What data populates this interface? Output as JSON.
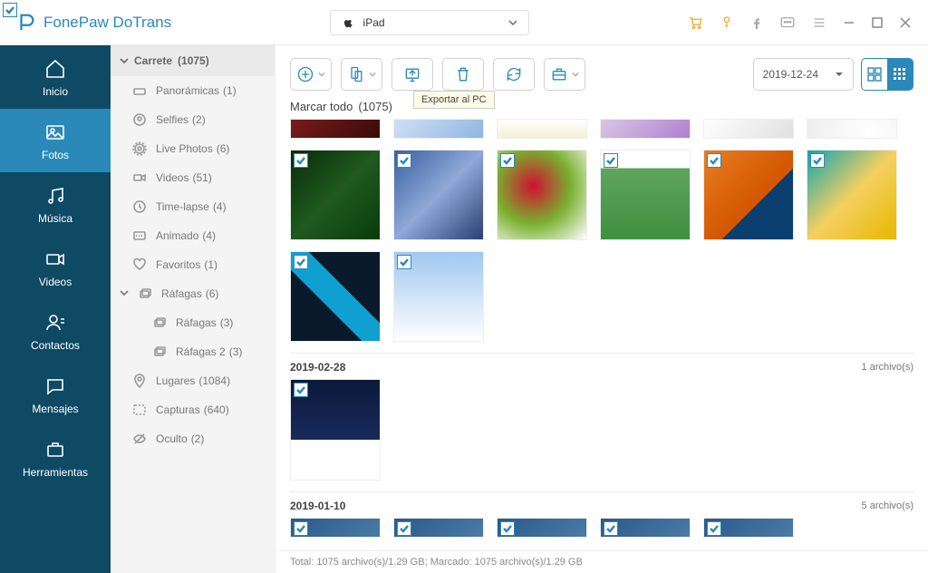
{
  "app": {
    "name": "FonePaw DoTrans"
  },
  "device": {
    "name": "iPad"
  },
  "sidebar": [
    {
      "key": "inicio",
      "label": "Inicio"
    },
    {
      "key": "fotos",
      "label": "Fotos"
    },
    {
      "key": "musica",
      "label": "Música"
    },
    {
      "key": "videos",
      "label": "Videos"
    },
    {
      "key": "contactos",
      "label": "Contactos"
    },
    {
      "key": "mensajes",
      "label": "Mensajes"
    },
    {
      "key": "herramientas",
      "label": "Herramientas"
    }
  ],
  "subsidebar": {
    "header": {
      "label": "Carrete",
      "count": "(1075)"
    },
    "items": [
      {
        "label": "Panorámicas",
        "count": "(1)"
      },
      {
        "label": "Selfies",
        "count": "(2)"
      },
      {
        "label": "Live Photos",
        "count": "(6)"
      },
      {
        "label": "Videos",
        "count": "(51)"
      },
      {
        "label": "Time-lapse",
        "count": "(4)"
      },
      {
        "label": "Animado",
        "count": "(4)"
      },
      {
        "label": "Favoritos",
        "count": "(1)"
      },
      {
        "expand": true,
        "label": "Ráfagas",
        "count": "(6)"
      },
      {
        "indent": true,
        "label": "Ráfagas",
        "count": "(3)"
      },
      {
        "indent": true,
        "label": "Ráfagas 2",
        "count": "(3)"
      },
      {
        "label": "Lugares",
        "count": "(1084)"
      },
      {
        "label": "Capturas",
        "count": "(640)"
      },
      {
        "label": "Oculto",
        "count": "(2)"
      }
    ]
  },
  "toolbar": {
    "export_tooltip": "Exportar al PC",
    "date": "2019-12-24"
  },
  "select_all": {
    "label": "Marcar todo",
    "count": "(1075)"
  },
  "groups": [
    {
      "date": "2019-02-28",
      "count_label": "1 archivo(s)"
    },
    {
      "date": "2019-01-10",
      "count_label": "5 archivo(s)"
    }
  ],
  "status": "Total: 1075 archivo(s)/1.29 GB; Marcado: 1075 archivo(s)/1.29 GB"
}
